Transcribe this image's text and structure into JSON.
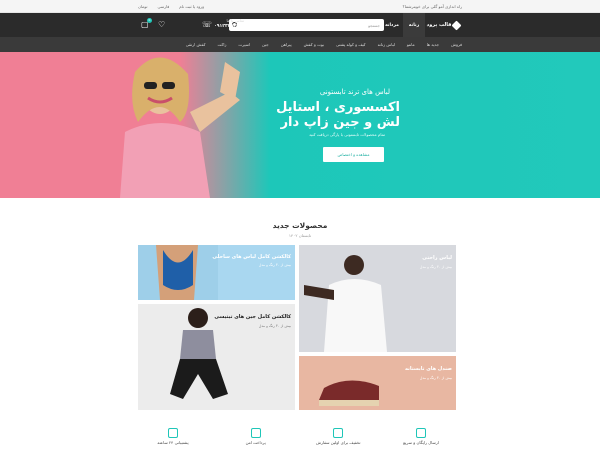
{
  "topbar": {
    "help_text": "راه اندازی آمو گلی برای خوبترشما؟",
    "login": "ورود یا ثبت نام",
    "language": "فارسی",
    "currency": "تومان"
  },
  "header": {
    "logo": "قالب پرود",
    "mode_women": "زنانه",
    "mode_men": "مردانه",
    "search_placeholder": "جستجو",
    "phone_label": "تماس با ما",
    "phone_number": "۰۹۱۲۳۴۵۶۷۸۹",
    "cart_count": "0",
    "accent": "#1fc6b8"
  },
  "categories": [
    "فروش",
    "جدید ها",
    "مانتو",
    "لباس زنانه",
    "کیف و کوله پشتی",
    "بوت و کفش",
    "پیراهن",
    "جین",
    "اسپرت",
    "زاکت",
    "کفش ارتقی"
  ],
  "hero": {
    "subtitle": "لباس های ترند تابستونی",
    "title": "اکسسوری ، استایل لش و جین زاپ دار",
    "desc": "تمام محصولات تابستونی با پارگی دریافت کنید",
    "cta": "مشاهده و اختصاص"
  },
  "new_products": {
    "title": "محصولات جدید",
    "date": "تابستان ۱۴۰۲"
  },
  "tiles": [
    {
      "name": "کالکشن کامل لباس های ساحلی",
      "sub": "بیش از ۳۰ رنگ و مدل"
    },
    {
      "name": "لباس راحتی",
      "sub": "بیش از ۳۰ رنگ و مدل"
    },
    {
      "name": "کالکشن کامل جین های تیتیسی",
      "sub": "بیش از ۳۰ رنگ و مدل"
    },
    {
      "name": "صندل های تابستانه",
      "sub": "بیش از ۳۰ رنگ و مدل"
    }
  ],
  "features": [
    {
      "label": "ارسال رایگان و سریع",
      "icon": "truck-icon"
    },
    {
      "label": "تخفیف برای اولین سفارش",
      "icon": "discount-icon"
    },
    {
      "label": "پرداخت امن",
      "icon": "card-icon"
    },
    {
      "label": "پشتیبانی ۲۴ ساعته",
      "icon": "support-icon"
    }
  ]
}
